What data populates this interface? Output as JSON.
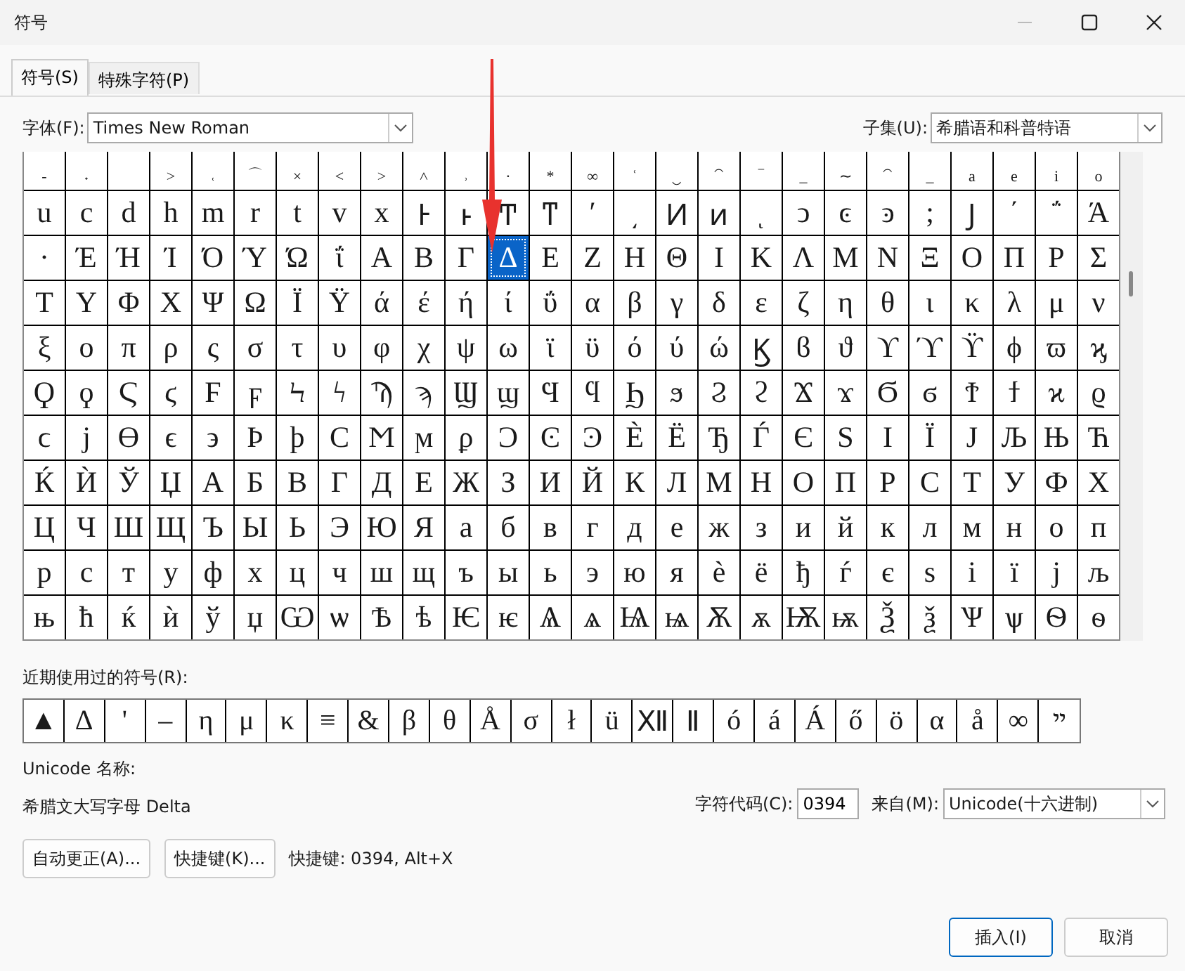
{
  "window": {
    "title": "符号"
  },
  "tabs": [
    {
      "label": "符号(S)",
      "selected": true
    },
    {
      "label": "特殊字符(P)",
      "selected": false
    }
  ],
  "font": {
    "label": "字体(F):",
    "value": "Times New Roman"
  },
  "subset": {
    "label": "子集(U):",
    "value": "希腊语和科普特语"
  },
  "grid": [
    [
      {
        "char": "‐",
        "selected": false
      },
      {
        "char": "˖",
        "selected": false
      },
      {
        "selected": false
      },
      {
        "char": "˃",
        "selected": false
      },
      {
        "char": "˓",
        "selected": false
      },
      {
        "char": "⌒",
        "selected": false
      },
      {
        "char": "×",
        "selected": false
      },
      {
        "char": "˂",
        "selected": false
      },
      {
        "char": "˃",
        "selected": false
      },
      {
        "char": "˄",
        "selected": false
      },
      {
        "char": "˒",
        "selected": false
      },
      {
        "char": "·",
        "selected": false
      },
      {
        "char": "*",
        "selected": false
      },
      {
        "char": "∞",
        "selected": false
      },
      {
        "char": "ʿ",
        "selected": false
      },
      {
        "char": "‿",
        "selected": false
      },
      {
        "char": "⁀",
        "selected": false
      },
      {
        "char": "‾",
        "selected": false
      },
      {
        "char": "_",
        "selected": false
      },
      {
        "char": "∼",
        "selected": false
      },
      {
        "char": "⁀",
        "selected": false
      },
      {
        "char": "_",
        "selected": false
      },
      {
        "char": "a",
        "selected": false
      },
      {
        "char": "e",
        "selected": false
      },
      {
        "char": "i",
        "selected": false
      },
      {
        "char": "o",
        "selected": false
      }
    ],
    [
      {
        "char": "u",
        "selected": false
      },
      {
        "char": "c",
        "selected": false
      },
      {
        "char": "d",
        "selected": false
      },
      {
        "char": "h",
        "selected": false
      },
      {
        "char": "m",
        "selected": false
      },
      {
        "char": "r",
        "selected": false
      },
      {
        "char": "t",
        "selected": false
      },
      {
        "char": "v",
        "selected": false
      },
      {
        "char": "x",
        "selected": false
      },
      {
        "char": "Ͱ",
        "selected": false
      },
      {
        "char": "ͱ",
        "selected": false
      },
      {
        "char": "Ͳ",
        "selected": false
      },
      {
        "char": "ͳ",
        "selected": false
      },
      {
        "char": "ʹ",
        "selected": false
      },
      {
        "char": "͵",
        "selected": false
      },
      {
        "char": "Ͷ",
        "selected": false
      },
      {
        "char": "ͷ",
        "selected": false
      },
      {
        "char": "ͺ",
        "selected": false
      },
      {
        "char": "ͻ",
        "selected": false
      },
      {
        "char": "ͼ",
        "selected": false
      },
      {
        "char": "ͽ",
        "selected": false
      },
      {
        "char": ";",
        "selected": false
      },
      {
        "char": "Ϳ",
        "selected": false
      },
      {
        "char": "΄",
        "selected": false
      },
      {
        "char": "΅",
        "selected": false
      },
      {
        "char": "Ά",
        "selected": false
      }
    ],
    [
      {
        "char": "·",
        "selected": false
      },
      {
        "char": "Έ",
        "selected": false
      },
      {
        "char": "Ή",
        "selected": false
      },
      {
        "char": "Ί",
        "selected": false
      },
      {
        "char": "Ό",
        "selected": false
      },
      {
        "char": "Ύ",
        "selected": false
      },
      {
        "char": "Ώ",
        "selected": false
      },
      {
        "char": "ΐ",
        "selected": false
      },
      {
        "char": "Α",
        "selected": false
      },
      {
        "char": "Β",
        "selected": false
      },
      {
        "char": "Γ",
        "selected": false
      },
      {
        "char": "Δ",
        "selected": true
      },
      {
        "char": "Ε",
        "selected": false
      },
      {
        "char": "Ζ",
        "selected": false
      },
      {
        "char": "Η",
        "selected": false
      },
      {
        "char": "Θ",
        "selected": false
      },
      {
        "char": "Ι",
        "selected": false
      },
      {
        "char": "Κ",
        "selected": false
      },
      {
        "char": "Λ",
        "selected": false
      },
      {
        "char": "Μ",
        "selected": false
      },
      {
        "char": "Ν",
        "selected": false
      },
      {
        "char": "Ξ",
        "selected": false
      },
      {
        "char": "Ο",
        "selected": false
      },
      {
        "char": "Π",
        "selected": false
      },
      {
        "char": "Ρ",
        "selected": false
      },
      {
        "char": "Σ",
        "selected": false
      }
    ],
    [
      {
        "char": "Τ",
        "selected": false
      },
      {
        "char": "Υ",
        "selected": false
      },
      {
        "char": "Φ",
        "selected": false
      },
      {
        "char": "Χ",
        "selected": false
      },
      {
        "char": "Ψ",
        "selected": false
      },
      {
        "char": "Ω",
        "selected": false
      },
      {
        "char": "Ϊ",
        "selected": false
      },
      {
        "char": "Ϋ",
        "selected": false
      },
      {
        "char": "ά",
        "selected": false
      },
      {
        "char": "έ",
        "selected": false
      },
      {
        "char": "ή",
        "selected": false
      },
      {
        "char": "ί",
        "selected": false
      },
      {
        "char": "ΰ",
        "selected": false
      },
      {
        "char": "α",
        "selected": false
      },
      {
        "char": "β",
        "selected": false
      },
      {
        "char": "γ",
        "selected": false
      },
      {
        "char": "δ",
        "selected": false
      },
      {
        "char": "ε",
        "selected": false
      },
      {
        "char": "ζ",
        "selected": false
      },
      {
        "char": "η",
        "selected": false
      },
      {
        "char": "θ",
        "selected": false
      },
      {
        "char": "ι",
        "selected": false
      },
      {
        "char": "κ",
        "selected": false
      },
      {
        "char": "λ",
        "selected": false
      },
      {
        "char": "μ",
        "selected": false
      },
      {
        "char": "ν",
        "selected": false
      }
    ],
    [
      {
        "char": "ξ",
        "selected": false
      },
      {
        "char": "ο",
        "selected": false
      },
      {
        "char": "π",
        "selected": false
      },
      {
        "char": "ρ",
        "selected": false
      },
      {
        "char": "ς",
        "selected": false
      },
      {
        "char": "σ",
        "selected": false
      },
      {
        "char": "τ",
        "selected": false
      },
      {
        "char": "υ",
        "selected": false
      },
      {
        "char": "φ",
        "selected": false
      },
      {
        "char": "χ",
        "selected": false
      },
      {
        "char": "ψ",
        "selected": false
      },
      {
        "char": "ω",
        "selected": false
      },
      {
        "char": "ϊ",
        "selected": false
      },
      {
        "char": "ϋ",
        "selected": false
      },
      {
        "char": "ό",
        "selected": false
      },
      {
        "char": "ύ",
        "selected": false
      },
      {
        "char": "ώ",
        "selected": false
      },
      {
        "char": "Ϗ",
        "selected": false
      },
      {
        "char": "ϐ",
        "selected": false
      },
      {
        "char": "ϑ",
        "selected": false
      },
      {
        "char": "ϒ",
        "selected": false
      },
      {
        "char": "ϓ",
        "selected": false
      },
      {
        "char": "ϔ",
        "selected": false
      },
      {
        "char": "ϕ",
        "selected": false
      },
      {
        "char": "ϖ",
        "selected": false
      },
      {
        "char": "ϗ",
        "selected": false
      }
    ],
    [
      {
        "char": "Ϙ",
        "selected": false
      },
      {
        "char": "ϙ",
        "selected": false
      },
      {
        "char": "Ϛ",
        "selected": false
      },
      {
        "char": "ϛ",
        "selected": false
      },
      {
        "char": "Ϝ",
        "selected": false
      },
      {
        "char": "ϝ",
        "selected": false
      },
      {
        "char": "Ϟ",
        "selected": false
      },
      {
        "char": "ϟ",
        "selected": false
      },
      {
        "char": "Ϡ",
        "selected": false
      },
      {
        "char": "ϡ",
        "selected": false
      },
      {
        "char": "Ϣ",
        "selected": false
      },
      {
        "char": "ϣ",
        "selected": false
      },
      {
        "char": "Ϥ",
        "selected": false
      },
      {
        "char": "ϥ",
        "selected": false
      },
      {
        "char": "Ϧ",
        "selected": false
      },
      {
        "char": "ϧ",
        "selected": false
      },
      {
        "char": "Ϩ",
        "selected": false
      },
      {
        "char": "ϩ",
        "selected": false
      },
      {
        "char": "Ϫ",
        "selected": false
      },
      {
        "char": "ϫ",
        "selected": false
      },
      {
        "char": "Ϭ",
        "selected": false
      },
      {
        "char": "ϭ",
        "selected": false
      },
      {
        "char": "Ϯ",
        "selected": false
      },
      {
        "char": "ϯ",
        "selected": false
      },
      {
        "char": "ϰ",
        "selected": false
      },
      {
        "char": "ϱ",
        "selected": false
      }
    ],
    [
      {
        "char": "ϲ",
        "selected": false
      },
      {
        "char": "ϳ",
        "selected": false
      },
      {
        "char": "ϴ",
        "selected": false
      },
      {
        "char": "ϵ",
        "selected": false
      },
      {
        "char": "϶",
        "selected": false
      },
      {
        "char": "Ϸ",
        "selected": false
      },
      {
        "char": "ϸ",
        "selected": false
      },
      {
        "char": "Ϲ",
        "selected": false
      },
      {
        "char": "Ϻ",
        "selected": false
      },
      {
        "char": "ϻ",
        "selected": false
      },
      {
        "char": "ϼ",
        "selected": false
      },
      {
        "char": "Ͻ",
        "selected": false
      },
      {
        "char": "Ͼ",
        "selected": false
      },
      {
        "char": "Ͽ",
        "selected": false
      },
      {
        "char": "Ѐ",
        "selected": false
      },
      {
        "char": "Ё",
        "selected": false
      },
      {
        "char": "Ђ",
        "selected": false
      },
      {
        "char": "Ѓ",
        "selected": false
      },
      {
        "char": "Є",
        "selected": false
      },
      {
        "char": "Ѕ",
        "selected": false
      },
      {
        "char": "І",
        "selected": false
      },
      {
        "char": "Ї",
        "selected": false
      },
      {
        "char": "Ј",
        "selected": false
      },
      {
        "char": "Љ",
        "selected": false
      },
      {
        "char": "Њ",
        "selected": false
      },
      {
        "char": "Ћ",
        "selected": false
      }
    ],
    [
      {
        "char": "Ќ",
        "selected": false
      },
      {
        "char": "Ѝ",
        "selected": false
      },
      {
        "char": "Ў",
        "selected": false
      },
      {
        "char": "Џ",
        "selected": false
      },
      {
        "char": "А",
        "selected": false
      },
      {
        "char": "Б",
        "selected": false
      },
      {
        "char": "В",
        "selected": false
      },
      {
        "char": "Г",
        "selected": false
      },
      {
        "char": "Д",
        "selected": false
      },
      {
        "char": "Е",
        "selected": false
      },
      {
        "char": "Ж",
        "selected": false
      },
      {
        "char": "З",
        "selected": false
      },
      {
        "char": "И",
        "selected": false
      },
      {
        "char": "Й",
        "selected": false
      },
      {
        "char": "К",
        "selected": false
      },
      {
        "char": "Л",
        "selected": false
      },
      {
        "char": "М",
        "selected": false
      },
      {
        "char": "Н",
        "selected": false
      },
      {
        "char": "О",
        "selected": false
      },
      {
        "char": "П",
        "selected": false
      },
      {
        "char": "Р",
        "selected": false
      },
      {
        "char": "С",
        "selected": false
      },
      {
        "char": "Т",
        "selected": false
      },
      {
        "char": "У",
        "selected": false
      },
      {
        "char": "Ф",
        "selected": false
      },
      {
        "char": "Х",
        "selected": false
      }
    ],
    [
      {
        "char": "Ц",
        "selected": false
      },
      {
        "char": "Ч",
        "selected": false
      },
      {
        "char": "Ш",
        "selected": false
      },
      {
        "char": "Щ",
        "selected": false
      },
      {
        "char": "Ъ",
        "selected": false
      },
      {
        "char": "Ы",
        "selected": false
      },
      {
        "char": "Ь",
        "selected": false
      },
      {
        "char": "Э",
        "selected": false
      },
      {
        "char": "Ю",
        "selected": false
      },
      {
        "char": "Я",
        "selected": false
      },
      {
        "char": "а",
        "selected": false
      },
      {
        "char": "б",
        "selected": false
      },
      {
        "char": "в",
        "selected": false
      },
      {
        "char": "г",
        "selected": false
      },
      {
        "char": "д",
        "selected": false
      },
      {
        "char": "е",
        "selected": false
      },
      {
        "char": "ж",
        "selected": false
      },
      {
        "char": "з",
        "selected": false
      },
      {
        "char": "и",
        "selected": false
      },
      {
        "char": "й",
        "selected": false
      },
      {
        "char": "к",
        "selected": false
      },
      {
        "char": "л",
        "selected": false
      },
      {
        "char": "м",
        "selected": false
      },
      {
        "char": "н",
        "selected": false
      },
      {
        "char": "о",
        "selected": false
      },
      {
        "char": "п",
        "selected": false
      }
    ],
    [
      {
        "char": "р",
        "selected": false
      },
      {
        "char": "с",
        "selected": false
      },
      {
        "char": "т",
        "selected": false
      },
      {
        "char": "у",
        "selected": false
      },
      {
        "char": "ф",
        "selected": false
      },
      {
        "char": "х",
        "selected": false
      },
      {
        "char": "ц",
        "selected": false
      },
      {
        "char": "ч",
        "selected": false
      },
      {
        "char": "ш",
        "selected": false
      },
      {
        "char": "щ",
        "selected": false
      },
      {
        "char": "ъ",
        "selected": false
      },
      {
        "char": "ы",
        "selected": false
      },
      {
        "char": "ь",
        "selected": false
      },
      {
        "char": "э",
        "selected": false
      },
      {
        "char": "ю",
        "selected": false
      },
      {
        "char": "я",
        "selected": false
      },
      {
        "char": "ѐ",
        "selected": false
      },
      {
        "char": "ё",
        "selected": false
      },
      {
        "char": "ђ",
        "selected": false
      },
      {
        "char": "ѓ",
        "selected": false
      },
      {
        "char": "є",
        "selected": false
      },
      {
        "char": "ѕ",
        "selected": false
      },
      {
        "char": "і",
        "selected": false
      },
      {
        "char": "ї",
        "selected": false
      },
      {
        "char": "ј",
        "selected": false
      },
      {
        "char": "љ",
        "selected": false
      }
    ],
    [
      {
        "char": "њ",
        "selected": false
      },
      {
        "char": "ћ",
        "selected": false
      },
      {
        "char": "ќ",
        "selected": false
      },
      {
        "char": "ѝ",
        "selected": false
      },
      {
        "char": "ў",
        "selected": false
      },
      {
        "char": "џ",
        "selected": false
      },
      {
        "char": "Ѡ",
        "selected": false
      },
      {
        "char": "ѡ",
        "selected": false
      },
      {
        "char": "Ѣ",
        "selected": false
      },
      {
        "char": "ѣ",
        "selected": false
      },
      {
        "char": "Ѥ",
        "selected": false
      },
      {
        "char": "ѥ",
        "selected": false
      },
      {
        "char": "Ѧ",
        "selected": false
      },
      {
        "char": "ѧ",
        "selected": false
      },
      {
        "char": "Ѩ",
        "selected": false
      },
      {
        "char": "ѩ",
        "selected": false
      },
      {
        "char": "Ѫ",
        "selected": false
      },
      {
        "char": "ѫ",
        "selected": false
      },
      {
        "char": "Ѭ",
        "selected": false
      },
      {
        "char": "ѭ",
        "selected": false
      },
      {
        "char": "Ѯ",
        "selected": false
      },
      {
        "char": "ѯ",
        "selected": false
      },
      {
        "char": "Ѱ",
        "selected": false
      },
      {
        "char": "ѱ",
        "selected": false
      },
      {
        "char": "Ѳ",
        "selected": false
      },
      {
        "char": "ѳ",
        "selected": false
      }
    ]
  ],
  "recent": {
    "label": "近期使用过的符号(R):",
    "symbols": [
      "▲",
      "Δ",
      "'",
      "–",
      "η",
      "μ",
      "κ",
      "≡",
      "&",
      "β",
      "θ",
      "Å",
      "σ",
      "ł",
      "ü",
      "Ⅻ",
      "Ⅱ",
      "ó",
      "á",
      "Á",
      "ő",
      "ö",
      "α",
      "å",
      "∞",
      "ײ"
    ]
  },
  "info": {
    "name_label": "Unicode 名称:",
    "name": "希腊文大写字母 Delta",
    "code_label": "字符代码(C):",
    "code": "0394",
    "from_label": "来自(M):",
    "from": "Unicode(十六进制)"
  },
  "buttons": {
    "autocorrect": "自动更正(A)...",
    "shortcut_key": "快捷键(K)...",
    "shortcut_text": "快捷键: 0394, Alt+X",
    "insert": "插入(I)",
    "cancel": "取消"
  }
}
